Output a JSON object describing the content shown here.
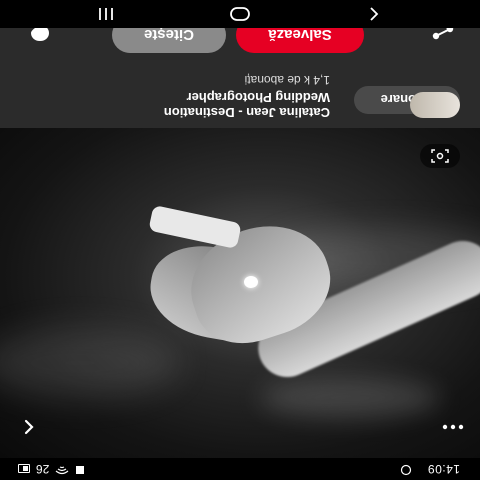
{
  "status_bar": {
    "time": "14:09",
    "signal_text": "26"
  },
  "pin": {
    "actions": {
      "save_label": "Salvează",
      "visit_label": "Citește"
    },
    "creator": {
      "name_line1": "Catalina Jean - Destination",
      "name_line2": "Wedding Photographer",
      "followers": "1,4 k de abonați",
      "follow_label": "Abonare"
    }
  },
  "icons": {
    "more": "more-dots-icon",
    "back": "chevron-left-icon",
    "lens": "visual-search-icon",
    "share": "share-icon",
    "comment": "comment-icon",
    "nav_back": "nav-back-icon",
    "nav_home": "nav-home-icon",
    "nav_recents": "nav-recents-icon"
  },
  "colors": {
    "save_button": "#e60023",
    "visit_button": "#8a8a8a",
    "panel": "#2b2b2b"
  }
}
